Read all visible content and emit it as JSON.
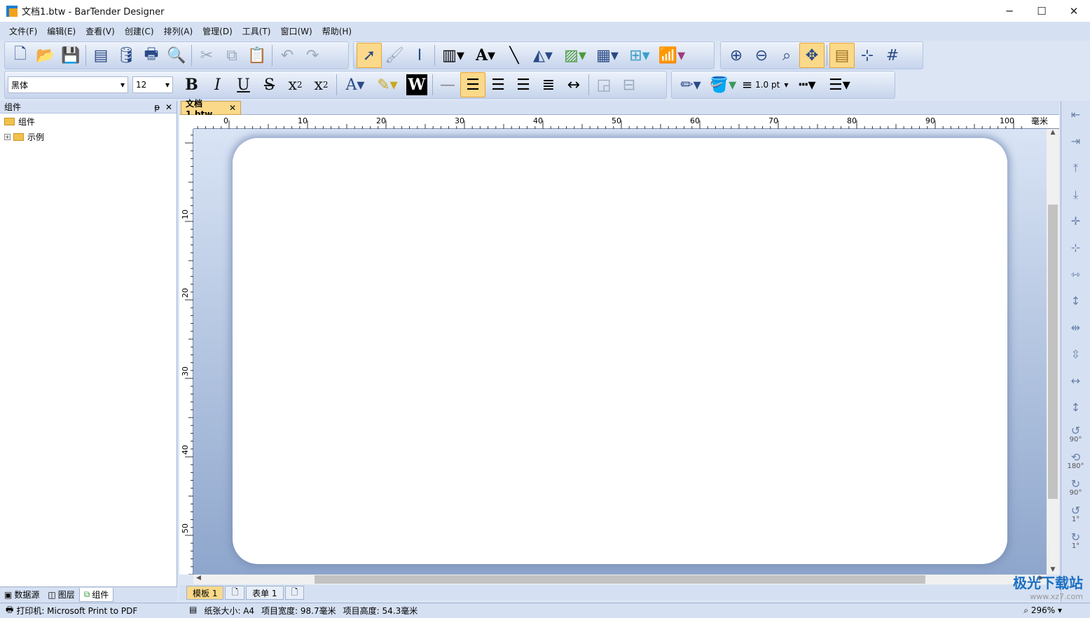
{
  "window": {
    "title": "文档1.btw - BarTender Designer",
    "minimize": "─",
    "maximize": "☐",
    "close": "✕"
  },
  "menu": [
    "文件(F)",
    "编辑(E)",
    "查看(V)",
    "创建(C)",
    "排列(A)",
    "管理(D)",
    "工具(T)",
    "窗口(W)",
    "帮助(H)"
  ],
  "format": {
    "font": "黑体",
    "size": "12",
    "line_width": "1.0 pt"
  },
  "components_panel": {
    "title": "组件",
    "pin": "ᵽ",
    "close": "✕",
    "root": "组件",
    "child": "示例"
  },
  "panel_tabs": [
    "数据源",
    "图层",
    "组件"
  ],
  "document_tab": {
    "label": "文档1.btw",
    "close": "✕"
  },
  "ruler": {
    "unit": "毫米",
    "h_ticks": [
      "0",
      "10",
      "20",
      "30",
      "40",
      "50",
      "60",
      "70",
      "80",
      "90",
      "100"
    ],
    "v_ticks": [
      "10",
      "20",
      "30",
      "40",
      "50"
    ]
  },
  "bottom_tabs": [
    "模板 1",
    "表单 1"
  ],
  "rotate_labels": [
    "90°",
    "180°",
    "90°",
    "1°",
    "1°"
  ],
  "status": {
    "printer": "打印机: Microsoft Print to PDF",
    "paper": "纸张大小: A4",
    "width": "项目宽度: 98.7毫米",
    "height": "项目高度: 54.3毫米",
    "zoom": "296%"
  },
  "watermark": {
    "name": "极光下载站",
    "url": "www.xz7.com"
  }
}
